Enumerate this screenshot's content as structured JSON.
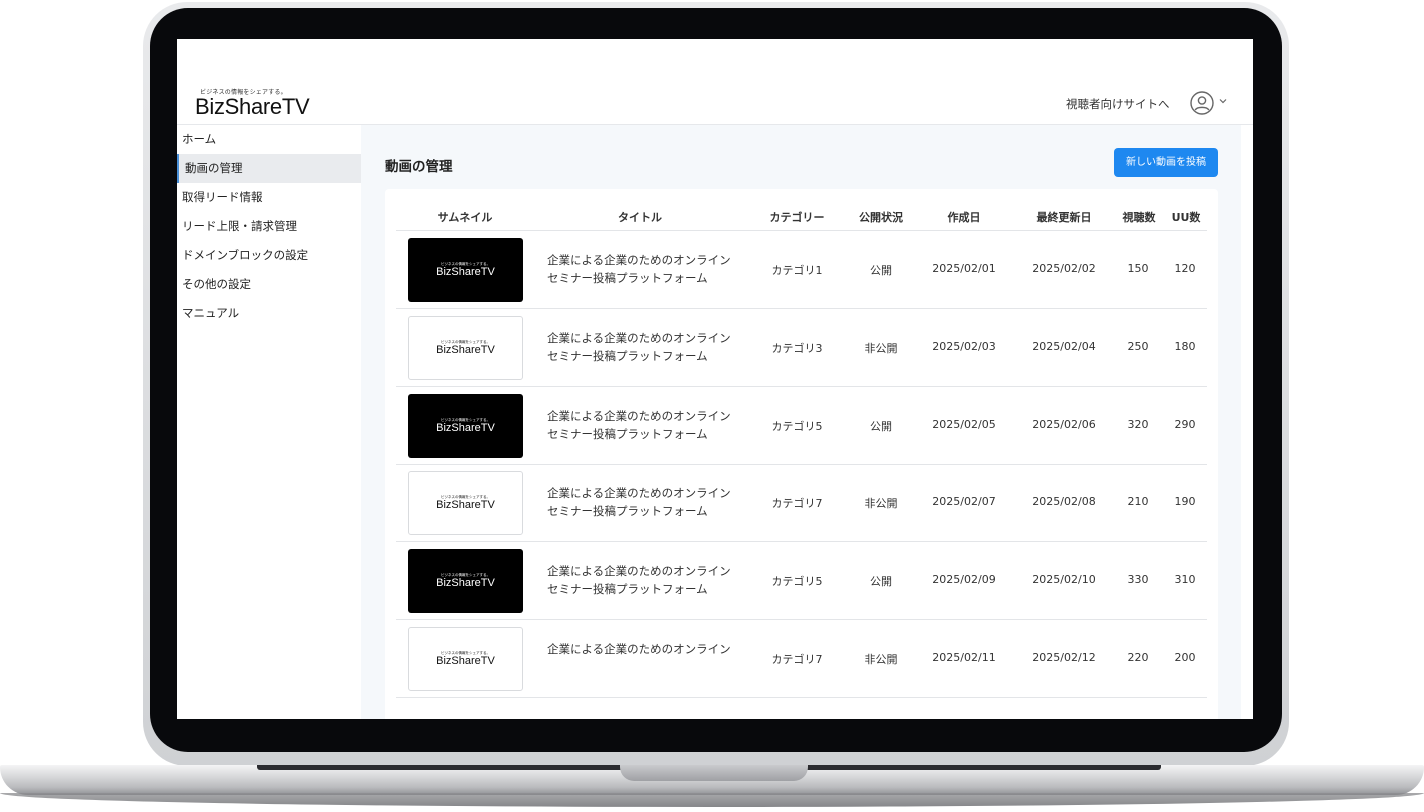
{
  "header": {
    "logo_tagline": "ビジネスの情報をシェアする。",
    "logo_text": "BizShareTV",
    "viewer_site_link": "視聴者向けサイトへ",
    "avatar_icon": "user-circle-icon",
    "caret_icon": "chevron-down-icon"
  },
  "sidebar": {
    "items": [
      {
        "label": "ホーム",
        "active": false
      },
      {
        "label": "動画の管理",
        "active": true
      },
      {
        "label": "取得リード情報",
        "active": false
      },
      {
        "label": "リード上限・請求管理",
        "active": false
      },
      {
        "label": "ドメインブロックの設定",
        "active": false
      },
      {
        "label": "その他の設定",
        "active": false
      },
      {
        "label": "マニュアル",
        "active": false
      }
    ]
  },
  "main": {
    "page_title": "動画の管理",
    "new_button": "新しい動画を投稿",
    "accent_color": "#1e88f0",
    "table": {
      "columns": [
        "サムネイル",
        "タイトル",
        "カテゴリー",
        "公開状況",
        "作成日",
        "最終更新日",
        "視聴数",
        "UU数"
      ],
      "rows": [
        {
          "thumb": "dark",
          "thumb_tag": "ビジネスの情報をシェアする。",
          "thumb_logo": "BizShareTV",
          "title_l1": "企業による企業のためのオンライン",
          "title_l2": "セミナー投稿プラットフォーム",
          "category": "カテゴリ1",
          "status": "公開",
          "created": "2025/02/01",
          "updated": "2025/02/02",
          "views": "150",
          "uu": "120"
        },
        {
          "thumb": "light",
          "thumb_tag": "ビジネスの情報をシェアする。",
          "thumb_logo": "BizShareTV",
          "title_l1": "企業による企業のためのオンライン",
          "title_l2": "セミナー投稿プラットフォーム",
          "category": "カテゴリ3",
          "status": "非公開",
          "created": "2025/02/03",
          "updated": "2025/02/04",
          "views": "250",
          "uu": "180"
        },
        {
          "thumb": "dark",
          "thumb_tag": "ビジネスの情報をシェアする。",
          "thumb_logo": "BizShareTV",
          "title_l1": "企業による企業のためのオンライン",
          "title_l2": "セミナー投稿プラットフォーム",
          "category": "カテゴリ5",
          "status": "公開",
          "created": "2025/02/05",
          "updated": "2025/02/06",
          "views": "320",
          "uu": "290"
        },
        {
          "thumb": "light",
          "thumb_tag": "ビジネスの情報をシェアする。",
          "thumb_logo": "BizShareTV",
          "title_l1": "企業による企業のためのオンライン",
          "title_l2": "セミナー投稿プラットフォーム",
          "category": "カテゴリ7",
          "status": "非公開",
          "created": "2025/02/07",
          "updated": "2025/02/08",
          "views": "210",
          "uu": "190"
        },
        {
          "thumb": "dark",
          "thumb_tag": "ビジネスの情報をシェアする。",
          "thumb_logo": "BizShareTV",
          "title_l1": "企業による企業のためのオンライン",
          "title_l2": "セミナー投稿プラットフォーム",
          "category": "カテゴリ5",
          "status": "公開",
          "created": "2025/02/09",
          "updated": "2025/02/10",
          "views": "330",
          "uu": "310"
        },
        {
          "thumb": "light",
          "thumb_tag": "ビジネスの情報をシェアする。",
          "thumb_logo": "BizShareTV",
          "title_l1": "企業による企業のためのオンライン",
          "title_l2": "",
          "category": "カテゴリ7",
          "status": "非公開",
          "created": "2025/02/11",
          "updated": "2025/02/12",
          "views": "220",
          "uu": "200"
        }
      ]
    }
  }
}
